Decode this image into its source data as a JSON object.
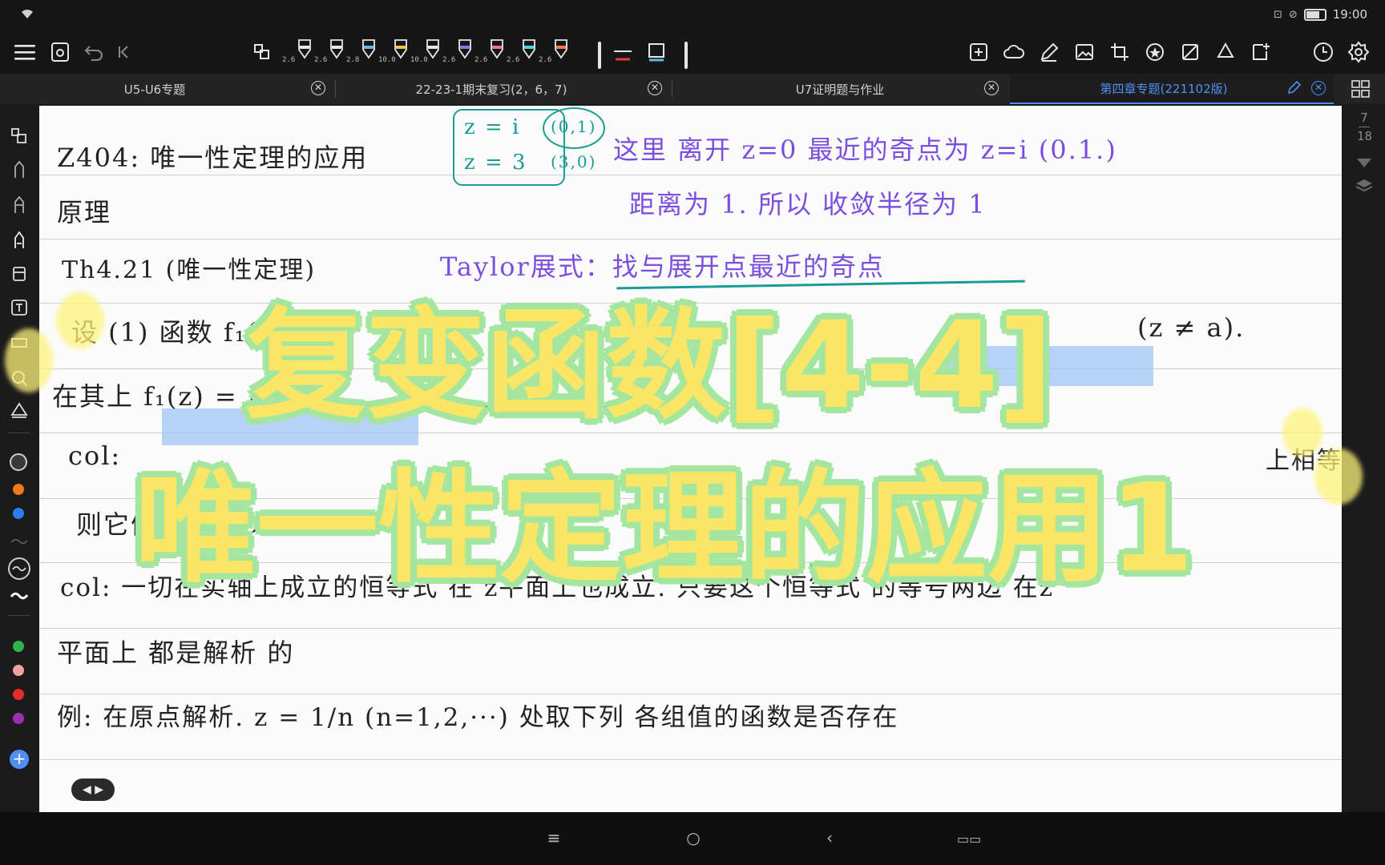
{
  "status_bar": {
    "time": "19:00"
  },
  "toolbar": {
    "pens": [
      {
        "size": "2.6",
        "color": "#e8e8e8"
      },
      {
        "size": "2.6",
        "color": "#e8e8e8"
      },
      {
        "size": "2.8",
        "color": "#5fb8f0"
      },
      {
        "size": "10.0",
        "color": "#f2c14e"
      },
      {
        "size": "10.0",
        "color": "#e8e8e8"
      },
      {
        "size": "2.6",
        "color": "#9b6cf0"
      },
      {
        "size": "2.6",
        "color": "#f06db0"
      },
      {
        "size": "2.6",
        "color": "#4fd3e8"
      },
      {
        "size": "2.6",
        "color": "#f07a4a"
      }
    ]
  },
  "tabs": [
    {
      "label": "U5-U6专题",
      "active": false
    },
    {
      "label": "22-23-1期末复习(2，6，7)",
      "active": false
    },
    {
      "label": "U7证明题与作业",
      "active": false
    },
    {
      "label": "第四章专题(221102版)",
      "active": true
    }
  ],
  "sidebar": {
    "palette": [
      "#3a3a3a",
      "#f07a1a",
      "#2e7df0",
      "#2fb24c",
      "#f2a0a0",
      "#e52b2b",
      "#9b2fb0"
    ]
  },
  "page_indicator": {
    "current": "7",
    "total": "18"
  },
  "note": {
    "line1_left": "Z404:  唯一性定理的应用",
    "teal_box_1": "z = i",
    "teal_box_2": "z = 3",
    "teal_pt_1": "(0,1)",
    "teal_pt_2": "(3,0)",
    "purple_1": "这里   离开 z=0 最近的奇点为 z=i (0.1.)",
    "purple_2": "距离为 1.  所以 收敛半径为 1",
    "line2": "原理",
    "line3": "Th4.21 (唯一性定理)",
    "purple_3": "Taylor展式：找与展开点最近的奇点",
    "line4": "设 (1) 函数 f₁(z)",
    "line4_end": "(z ≠ a).",
    "line5": "在其上 f₁(z) = f₂(z)",
    "line6": "col:",
    "line6_end": "上相等.",
    "line7": "则它们在区域D内",
    "line8": "col:  一切在实轴上成立的恒等式 在 z平面上也成立. 只要这个恒等式 的等号两边 在z",
    "line9": "平面上 都是解析 的",
    "line10": "例:  在原点解析. z = 1/n (n=1,2,···) 处取下列 各组值的函数是否存在"
  },
  "overlay_title": {
    "line1": "复变函数[4-4]",
    "line2": "唯一性定理的应用1"
  }
}
